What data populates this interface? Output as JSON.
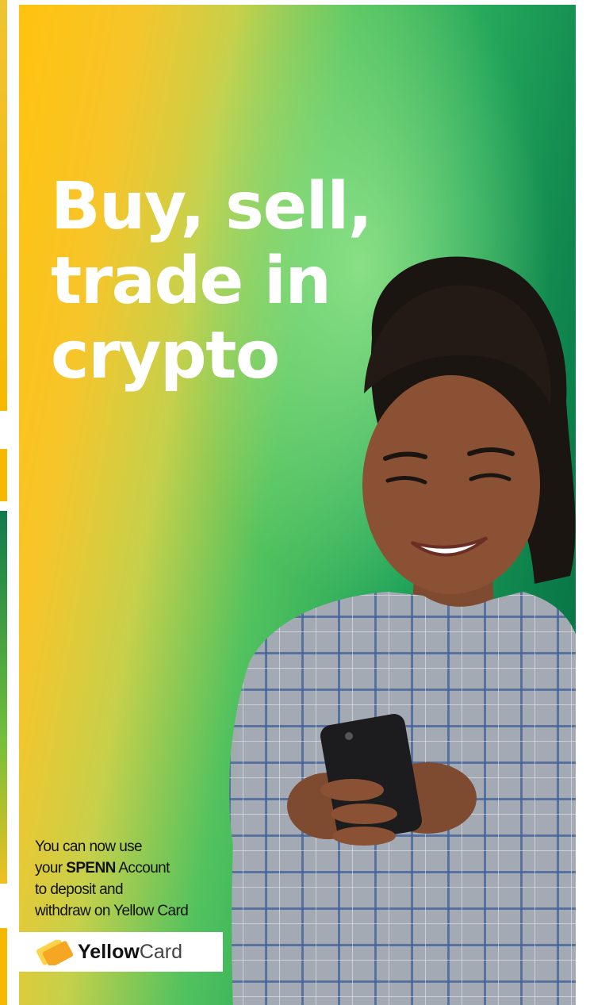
{
  "headline": [
    "Buy, sell,",
    "trade in",
    "crypto"
  ],
  "caption": {
    "line1": "You can now use",
    "line2_pre": "your ",
    "line2_bold": "SPENN",
    "line2_post": " Account",
    "line3": "to deposit and",
    "line4": "withdraw on Yellow Card"
  },
  "logo": {
    "word_bold": "Yellow",
    "word_light": "Card",
    "icon": "yellow-card-logo-icon"
  },
  "colors": {
    "yellow": "#ffc20e",
    "green": "#22a55a",
    "dark_green": "#066a3e",
    "text_white": "#ffffff"
  }
}
